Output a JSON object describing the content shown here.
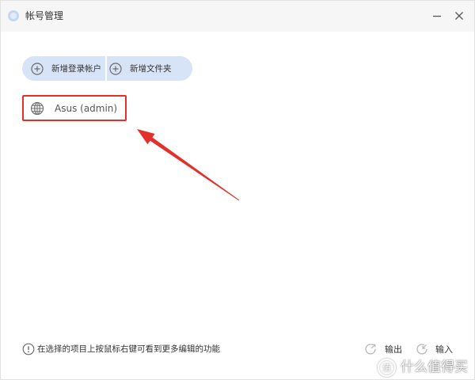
{
  "window": {
    "title": "帐号管理"
  },
  "toolbar": {
    "add_login_account_label": "新增登录帐户",
    "add_folder_label": "新增文件夹"
  },
  "accounts": [
    {
      "label": "Asus (admin)",
      "icon": "globe-icon"
    }
  ],
  "footer": {
    "hint": "在选择的项目上按鼠标右键可看到更多编辑的功能",
    "export_label": "输出",
    "import_label": "输入"
  },
  "watermark": {
    "logo_char": "值",
    "text": "什么值得买"
  },
  "icons": {
    "app": "app-logo-icon",
    "minimize": "minimize-icon",
    "close": "close-icon",
    "add": "plus-circle-icon",
    "account": "globe-icon",
    "info": "info-icon",
    "export": "export-icon",
    "import": "import-icon"
  },
  "colors": {
    "titlebar_bg": "#f6f6f6",
    "body_bg": "#ffffff",
    "window_border": "#e2e2e2",
    "pill_bg": "#d7e3f6",
    "pill_divider": "#ffffff",
    "text_primary": "#333333",
    "text_secondary": "#555555",
    "icon_dark": "#555555",
    "icon_gray": "#6b6b6b",
    "icon_light": "#b8b8b8",
    "app_icon": "#c3d6f2",
    "annotation_red": "#e3302a",
    "watermark": "#ffffff"
  }
}
